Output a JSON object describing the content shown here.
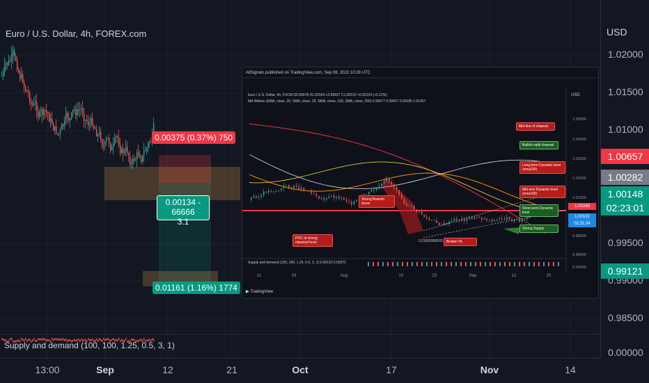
{
  "symbol": {
    "title": "Euro / U.S. Dollar, 4h, FOREX.com"
  },
  "price_axis": {
    "unit": "USD",
    "labels": [
      "1.02000",
      "1.01500",
      "1.01000",
      "0.99500",
      "0.99000",
      "0.98500",
      "0.00000"
    ],
    "tags": [
      {
        "text": "1.00657",
        "color": "#f23645"
      },
      {
        "text": "1.00282",
        "color": "#787b86"
      },
      {
        "text": "1.00148",
        "color": "#089981"
      },
      {
        "text": "02:23:01",
        "color": "#089981"
      },
      {
        "text": "0.99121",
        "color": "#089981"
      }
    ]
  },
  "time_axis": {
    "labels": [
      "13:00",
      "Sep",
      "12",
      "21",
      "Oct",
      "17",
      "Nov",
      "14"
    ]
  },
  "position": {
    "stop_label": "0.00375 (0.37%) 750",
    "center_label_1": "0.00134 - 66666",
    "center_label_2": "3.1",
    "target_label": "0.01161 (1.16%) 1774"
  },
  "indicator": {
    "label": "Supply and demand (100, 100, 1.25, 0.5, 3, 1)"
  },
  "inset": {
    "header": "AllSignals published on TradingView.com, Sep 08, 2022 10:28 UTC",
    "symbol_line": "Euro / U.S. Dollar, 4h, FXCM  O0.99978  H1.00164  L0.99927  C1.00102  +0.00124 (+0.12%)",
    "ma_line": "MA Ribbon (EMA, close, 20, SMA, close, 25, SMA, close, 100, SMA, close, 200)  0.99577  0.99427  0.99185  1.01057",
    "unit": "USD",
    "axis_labels": [
      "1.05000",
      "1.04000",
      "1.03000",
      "1.02000",
      "1.01000",
      "0.99000",
      "0.98000",
      "0.00000"
    ],
    "tags": [
      "1.00248",
      "1.00102",
      "02:31:34"
    ],
    "time_labels": [
      "11",
      "19",
      "Aug",
      "15",
      "23",
      "Sep",
      "12",
      "20"
    ],
    "notes": {
      "mid_line": "Mid-line of channel",
      "bullish": "Bullish valid channel",
      "long_term": "Long-term Dynamic level (sma200)",
      "mid_term": "Mid-erm Dynamic level (sma100)",
      "short_term": "Short-term Dynamic level",
      "strong_supply": "Strong Supply",
      "bearish": "Strong Bearish move",
      "poc": "POC of strong classical level",
      "broken_hl": "Broken HL"
    },
    "number_text": "0.21603956503",
    "supply_line": "Supply and demand (100, 100, 1.25, 0.5, 3, 1)  0.00133  0.00372",
    "footer": "TradingView"
  },
  "colors": {
    "up": "#26a69a",
    "down": "#ef5350",
    "bg": "#131722",
    "inset_bg": "#0e111a"
  }
}
